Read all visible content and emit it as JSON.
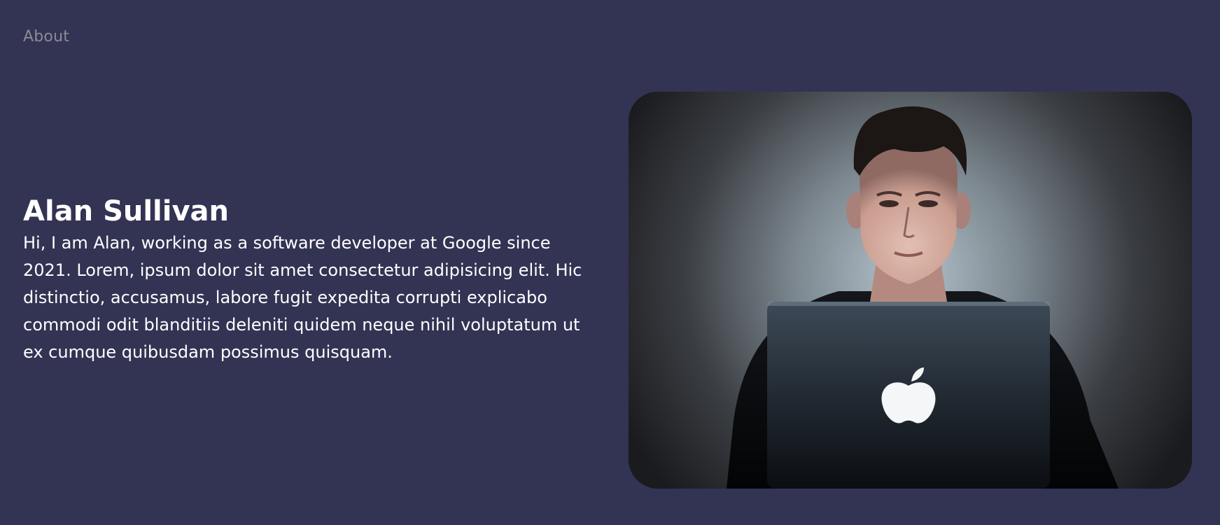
{
  "nav": {
    "about_label": "About"
  },
  "intro": {
    "name": "Alan Sullivan",
    "bio": "Hi, I am Alan, working as a software developer at Google since 2021. Lorem, ipsum dolor sit amet consectetur adipisicing elit. Hic distinctio, accusamus, labore fugit expedita corrupti explicabo commodi odit blanditiis deleniti quidem neque nihil voluptatum ut ex cumque quibusdam possimus quisquam."
  },
  "photo": {
    "subject": "person-with-laptop"
  },
  "colors": {
    "background": "#333354",
    "nav_text": "#8b8b97",
    "text": "#ffffff"
  }
}
